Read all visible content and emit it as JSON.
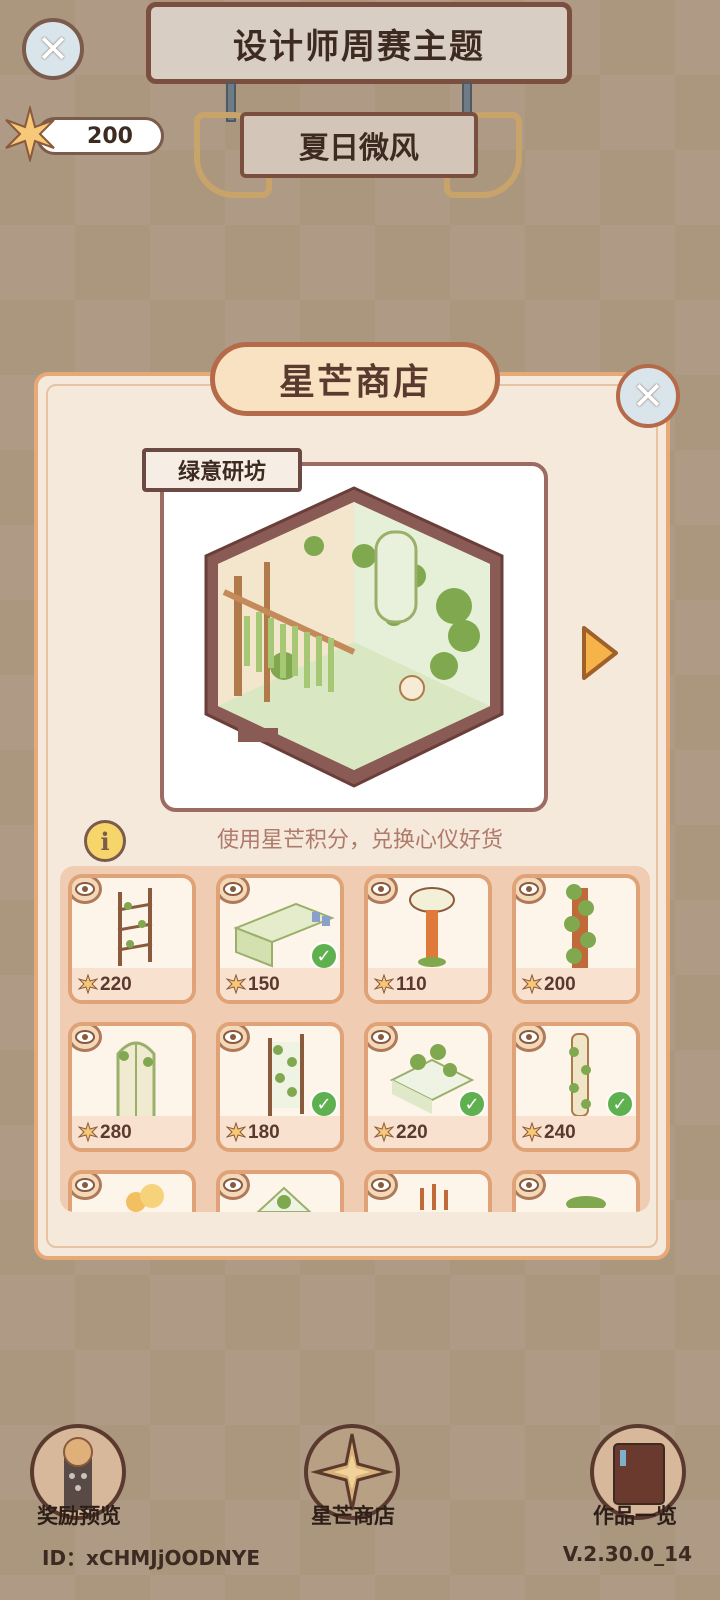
{
  "header": {
    "title": "设计师周赛主题",
    "theme": "夏日微风",
    "currency_value": "200"
  },
  "shop": {
    "title": "星芒商店",
    "room_name": "绿意研坊",
    "hint": "使用星芒积分，兑换心仪好货"
  },
  "items": [
    {
      "price": "220",
      "owned": false
    },
    {
      "price": "150",
      "owned": true
    },
    {
      "price": "110",
      "owned": false
    },
    {
      "price": "200",
      "owned": false
    },
    {
      "price": "280",
      "owned": false
    },
    {
      "price": "180",
      "owned": true
    },
    {
      "price": "220",
      "owned": true
    },
    {
      "price": "240",
      "owned": true
    }
  ],
  "bottom_nav": {
    "rewards": "奖励预览",
    "shop": "星芒商店",
    "works": "作品一览"
  },
  "footer": {
    "id": "ID：xCHMJjOODNYE",
    "version": "V.2.30.0_14"
  },
  "colors": {
    "accent": "#e7a977",
    "brown": "#7b5b4b",
    "check": "#5fb04e"
  }
}
